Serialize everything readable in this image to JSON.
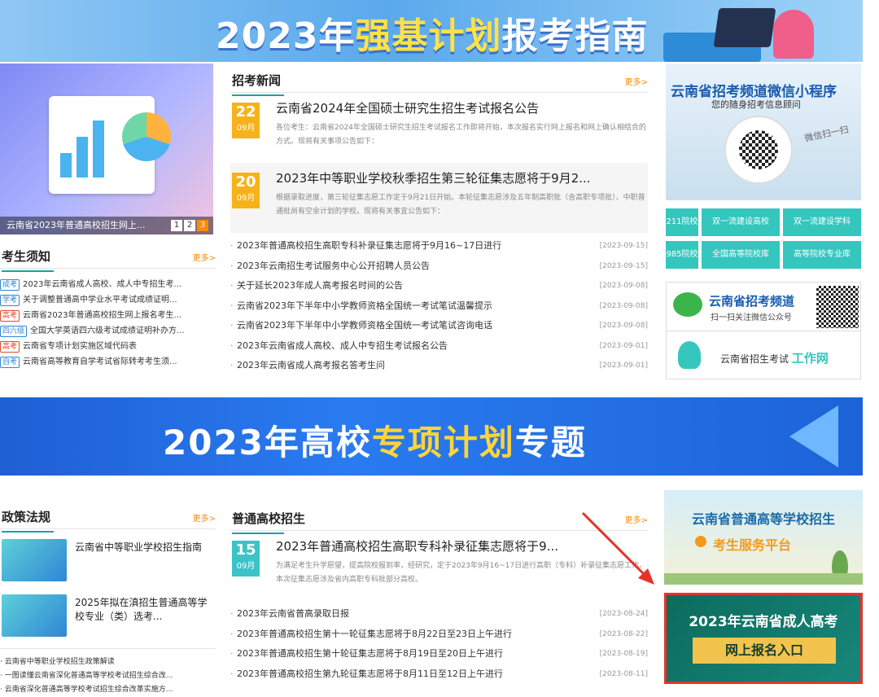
{
  "top_banner": {
    "title_part1": "2023年",
    "title_highlight": "强基计划",
    "title_part2": "报考指南"
  },
  "carousel": {
    "caption": "云南省2023年普通高校招生网上...",
    "pages": [
      "1",
      "2",
      "3"
    ],
    "active": 3
  },
  "notice": {
    "title": "考生须知",
    "more": "更多>",
    "items": [
      {
        "tag": "成考",
        "tag_color": "#2f86d6",
        "text": "2023年云南省成人高校、成人中专招生考..."
      },
      {
        "tag": "学考",
        "tag_color": "#2f86d6",
        "text": "关于调整普通高中学业水平考试成绩证明..."
      },
      {
        "tag": "高考",
        "tag_color": "#e04a2a",
        "text": "云南省2023年普通高校招生网上报名考生..."
      },
      {
        "tag": "四六级",
        "tag_color": "#2f86d6",
        "text": "全国大学英语四六级考试成绩证明补办方..."
      },
      {
        "tag": "高考",
        "tag_color": "#e04a2a",
        "text": "云南省专项计划实施区域代码表"
      },
      {
        "tag": "自考",
        "tag_color": "#2f86d6",
        "text": "云南省高等教育自学考试省际转考考生须..."
      }
    ]
  },
  "news": {
    "title": "招考新闻",
    "more": "更多>",
    "featured": [
      {
        "day": "22",
        "month": "09月",
        "title": "云南省2024年全国硕士研究生招生考试报名公告",
        "summary": "各位考生：云南省2024年全国硕士研究生招生考试报名工作即将开始，本次报名实行网上报名和网上确认相结合的方式。现将有关事项公告如下："
      },
      {
        "day": "20",
        "month": "09月",
        "title": "2023年中等职业学校秋季招生第三轮征集志愿将于9月2...",
        "summary": "根据录取进度，第三轮征集志愿工作定于9月21日开始。本轮征集志愿涉及五年制高职批（含高职专项批）、中职普通批尚有空余计划的学校。现将有关事宜公告如下："
      }
    ],
    "list": [
      {
        "text": "2023年普通高校招生高职专科补录征集志愿将于9月16~17日进行",
        "date": "[2023-09-15]"
      },
      {
        "text": "2023年云南招生考试服务中心公开招聘人员公告",
        "date": "[2023-09-15]"
      },
      {
        "text": "关于延长2023年成人高考报名时间的公告",
        "date": "[2023-09-08]"
      },
      {
        "text": "云南省2023年下半年中小学教师资格全国统一考试笔试温馨提示",
        "date": "[2023-09-08]"
      },
      {
        "text": "云南省2023年下半年中小学教师资格全国统一考试笔试咨询电话",
        "date": "[2023-09-08]"
      },
      {
        "text": "2023年云南省成人高校、成人中专招生考试报名公告",
        "date": "[2023-09-01]"
      },
      {
        "text": "2023年云南省成人高考报名答考生问",
        "date": "[2023-09-01]"
      }
    ]
  },
  "miniapp": {
    "title": "云南省招考频道微信小程序",
    "subtitle": "您的随身招考信息顾问",
    "hint": "微信扫一扫"
  },
  "quick_buttons": [
    "211院校",
    "双一流建设高校",
    "双一流建设学科",
    "985院校",
    "全国高等院校库",
    "高等院校专业库"
  ],
  "wechat": {
    "name": "云南省招考频道",
    "desc": "扫一扫关注微信公众号",
    "portal_prefix": "云南省招生考试",
    "portal_highlight": "工作网"
  },
  "mid_banner": {
    "title_part1": "2023年高校",
    "title_highlight": "专项计划",
    "title_part2": "专题"
  },
  "policy": {
    "title": "政策法规",
    "more": "更多>",
    "items": [
      {
        "title": "云南省中等职业学校招生指南"
      },
      {
        "title": "2025年拟在滇招生普通高等学校专业（类）选考..."
      }
    ],
    "list": [
      "云南省中等职业学校招生政策解读",
      "一图读懂云南省深化普通高等学校考试招生综合改...",
      "云南省深化普通高等学校考试招生综合改革实施方..."
    ]
  },
  "general": {
    "title": "普通高校招生",
    "more": "更多>",
    "featured": {
      "day": "15",
      "month": "09月",
      "title": "2023年普通高校招生高职专科补录征集志愿将于9...",
      "summary": "为满足考生升学愿望，提高院校报到率，经研究，定于2023年9月16~17日进行高职（专科）补录征集志愿工作。本次征集志愿涉及省内高职专科批部分高校。"
    },
    "list": [
      {
        "text": "2023年云南省普高录取日报",
        "date": "[2023-08-24]"
      },
      {
        "text": "2023年普通高校招生第十一轮征集志愿将于8月22日至23日上午进行",
        "date": "[2023-08-22]"
      },
      {
        "text": "2023年普通高校招生第十轮征集志愿将于8月19日至20日上午进行",
        "date": "[2023-08-19]"
      },
      {
        "text": "2023年普通高校招生第九轮征集志愿将于8月11日至12日上午进行",
        "date": "[2023-08-11]"
      }
    ]
  },
  "service": {
    "title": "云南省普通高等学校招生",
    "subtitle": "考生服务平台"
  },
  "adult_entry": {
    "title": "2023年云南省成人高考",
    "button": "网上报名入口",
    "highlight_color": "#e5332a"
  }
}
